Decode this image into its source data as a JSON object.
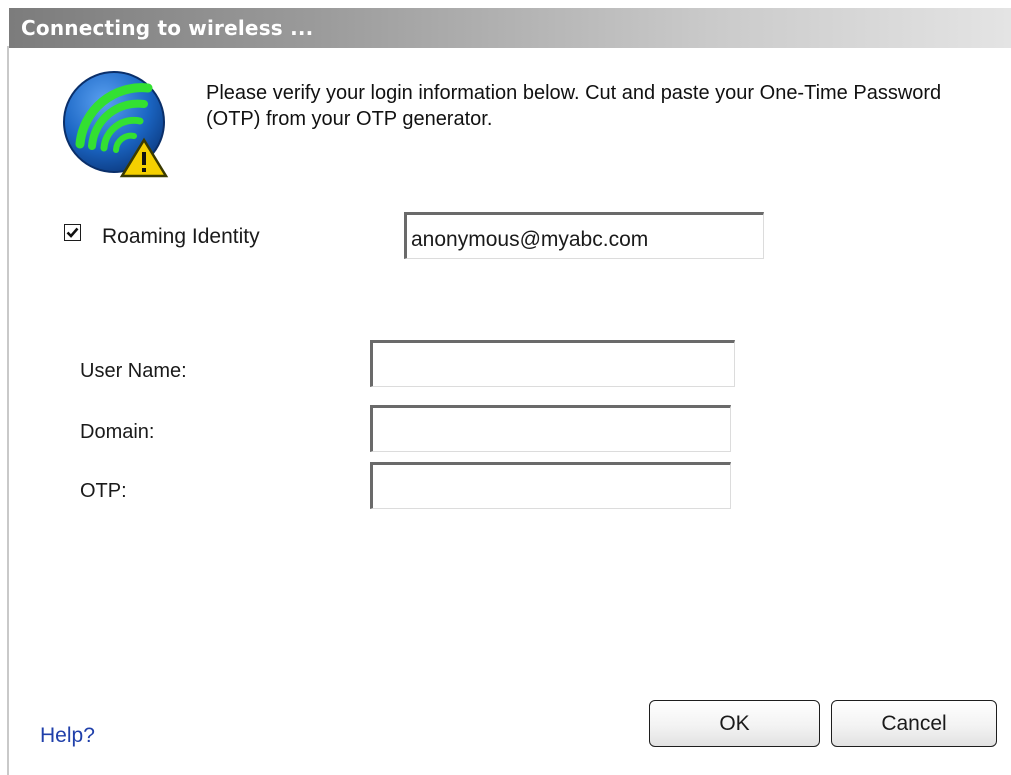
{
  "window": {
    "title": "Connecting to wireless ..."
  },
  "icon": {
    "name": "wireless-warning-icon"
  },
  "message": "Please verify your login information below. Cut and paste your One-Time Password (OTP) from your OTP generator.",
  "roaming": {
    "checked": true,
    "label": "Roaming Identity",
    "value": "anonymous@myabc.com"
  },
  "fields": {
    "username": {
      "label": "User Name:",
      "value": ""
    },
    "domain": {
      "label": "Domain:",
      "value": ""
    },
    "otp": {
      "label": "OTP:",
      "value": ""
    }
  },
  "footer": {
    "help_label": "Help?",
    "ok_label": "OK",
    "cancel_label": "Cancel"
  },
  "colors": {
    "titlebar_start": "#7c7c7c",
    "titlebar_end": "#e4e4e4",
    "help_link": "#1f3faa",
    "icon_blue": "#1b66c4",
    "icon_green": "#33e032",
    "warning_yellow": "#f5d000"
  }
}
